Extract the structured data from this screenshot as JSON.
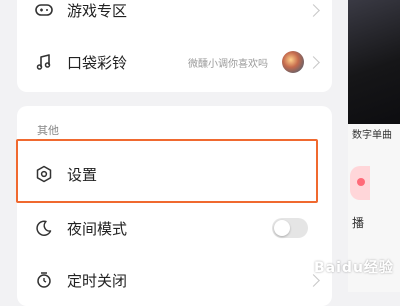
{
  "menu": {
    "game_zone": "游戏专区",
    "pocket_ringtone": "口袋彩铃",
    "pocket_ringtone_sub": "微醺小调你喜欢吗",
    "other_section": "其他",
    "settings": "设置",
    "night_mode": "夜间模式",
    "timer_off": "定时关闭"
  },
  "night_mode_enabled": false,
  "background": {
    "digital_single": "数字单曲",
    "broadcast": "播"
  },
  "watermark": "Baidu经验",
  "highlight_color": "#f0692f",
  "icons": {
    "game": "gamepad-icon",
    "ringtone": "music-note-icon",
    "settings": "hexagon-gear-icon",
    "night": "moon-icon",
    "timer": "alarm-clock-icon"
  }
}
